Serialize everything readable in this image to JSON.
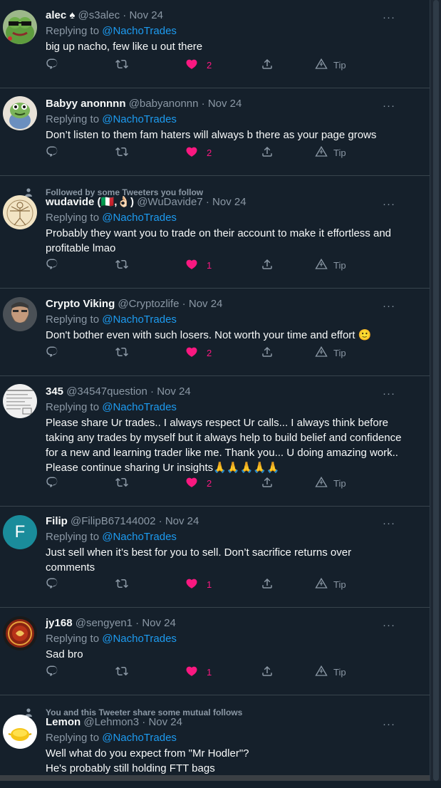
{
  "tweets": [
    {
      "name": "alec ♠",
      "handle": "@s3alec",
      "date": "Nov 24",
      "replying_label": "Replying to",
      "replying_to": "@NachoTrades",
      "body": [
        "big up nacho, few like u out there"
      ],
      "likes": "2",
      "tip_label": "Tip",
      "avatar": "frog-sunglasses"
    },
    {
      "name": "Babyy anonnnn",
      "handle": "@babyanonnn",
      "date": "Nov 24",
      "replying_label": "Replying to",
      "replying_to": "@NachoTrades",
      "body": [
        "Don’t listen to them fam haters will always b there as your page grows"
      ],
      "likes": "2",
      "tip_label": "Tip",
      "avatar": "frog-cartoon"
    },
    {
      "social_context": "Followed by some Tweeters you follow",
      "name": "wudavide (🇮🇹,👌🏻)",
      "handle": "@WuDavide7",
      "date": "Nov 24",
      "replying_label": "Replying to",
      "replying_to": "@NachoTrades",
      "body": [
        "Probably they want you to trade on their account to make it effortless and",
        "profitable lmao"
      ],
      "likes": "1",
      "tip_label": "Tip",
      "avatar": "vitruvian-sketch"
    },
    {
      "name": "Crypto Viking",
      "handle": "@Cryptozlife",
      "date": "Nov 24",
      "replying_label": "Replying to",
      "replying_to": "@NachoTrades",
      "body": [
        "Don't bother even with such losers. Not worth your time and effort 🙂"
      ],
      "likes": "2",
      "tip_label": "Tip",
      "avatar": "bearded-man"
    },
    {
      "name": "345",
      "handle": "@34547question",
      "date": "Nov 24",
      "replying_label": "Replying to",
      "replying_to": "@NachoTrades",
      "body": [
        "Please share Ur trades.. I always respect Ur calls... I always think before",
        "taking any trades by myself but it always help to build belief and confidence",
        "for a new and learning trader like me. Thank you... U doing amazing work..",
        "Please continue sharing Ur insights🙏🙏🙏🙏🙏"
      ],
      "likes": "2",
      "tip_label": "Tip",
      "avatar": "document-scan"
    },
    {
      "name": "Filip",
      "handle": "@FilipB67144002",
      "date": "Nov 24",
      "replying_label": "Replying to",
      "replying_to": "@NachoTrades",
      "body": [
        "Just sell when it’s best for you to sell. Don’t sacrifice returns over",
        "comments"
      ],
      "likes": "1",
      "tip_label": "Tip",
      "avatar_letter": "F",
      "avatar": "letter",
      "avatar_color": "#1a8c9b"
    },
    {
      "name": "jy168",
      "handle": "@sengyen1",
      "date": "Nov 24",
      "replying_label": "Replying to",
      "replying_to": "@NachoTrades",
      "body": [
        "Sad bro"
      ],
      "likes": "1",
      "tip_label": "Tip",
      "avatar": "red-medallion"
    },
    {
      "social_context": "You and this Tweeter share some mutual follows",
      "name": "Lemon",
      "handle": "@Lehmon3",
      "date": "Nov 24",
      "replying_label": "Replying to",
      "replying_to": "@NachoTrades",
      "body": [
        "Well what do you expect from \"Mr Hodler\"?",
        "He's probably still holding FTT bags"
      ],
      "avatar": "lemon"
    }
  ],
  "colors": {
    "background": "#15202b",
    "link": "#1d9bf0",
    "secondary_text": "#8b98a5",
    "like": "#f91880",
    "divider": "#38444d"
  }
}
